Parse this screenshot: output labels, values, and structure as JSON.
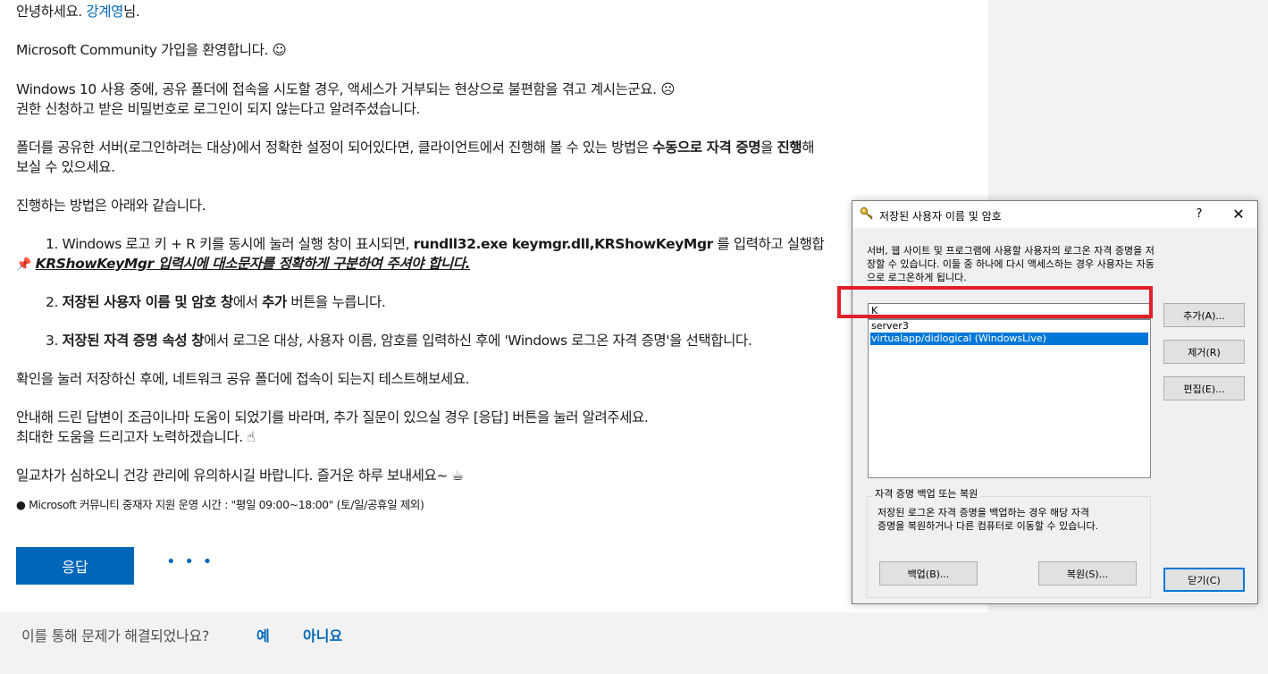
{
  "post": {
    "greeting_prefix": "안녕하세요. ",
    "greeting_name": "강계영",
    "greeting_suffix": "님.",
    "welcome": "Microsoft Community 가입을 환영합니다. ☺",
    "issue_line1": "Windows 10 사용 중에, 공유 폴더에 접속을 시도할 경우, 액세스가 거부되는 현상으로 불편함을 겪고 계시는군요. ☹",
    "issue_line2": "권한 신청하고 받은 비밀번호로 로그인이 되지 않는다고 알려주셨습니다.",
    "cause_pre": "폴더를 공유한 서버(로그인하려는 대상)에서 정확한 설정이 되어있다면, 클라이언트에서 진행해 볼 수 있는 방법은 ",
    "cause_b1": "수동으로 자격 증명",
    "cause_mid": "을 ",
    "cause_b2": "진행",
    "cause_post": "해",
    "cause_line2": "보실 수 있으세요.",
    "method_intro": "진행하는 방법은 아래와 같습니다.",
    "step1_pre": "1. Windows 로고 키 + R 키를 동시에 눌러 실행 창이 표시되면, ",
    "step1_cmd": "rundll32.exe keymgr.dll,KRShowKeyMgr",
    "step1_post": " 를 입력하고 실행합",
    "step1_note": "KRShowKeyMgr 입력시에 대소문자를 정확하게 구분하여 주셔야 합니다.",
    "step2_pre": "2. ",
    "step2_b1": "저장된 사용자 이름 및 암호 창",
    "step2_mid": "에서 ",
    "step2_b2": "추가",
    "step2_post": " 버튼을 누릅니다.",
    "step3_pre": "3. ",
    "step3_b1": "저장된 자격 증명 속성 창",
    "step3_post": "에서 로그온 대상, 사용자 이름, 암호를 입력하신 후에 'Windows 로그온 자격 증명'을 선택합니다.",
    "confirm": "확인을 눌러 저장하신 후에, 네트워크 공유 폴더에 접속이 되는지 테스트해보세요.",
    "closing1": "안내해 드린 답변이 조금이나마 도움이 되었기를 바라며, 추가 질문이 있으실 경우 [응답] 버튼을 눌러 알려주세요.",
    "closing2": "최대한 도움을 드리고자 노력하겠습니다. ☝",
    "farewell": "일교차가 심하오니 건강 관리에 유의하시길 바랍니다. 즐거운 하루 보내세요~ ☕",
    "hours_note": "● Microsoft 커뮤니티 중재자 지원 운영 시간 : \"평일 09:00~18:00\" (토/일/공휴일 제외)",
    "reply_button": "응답",
    "more_dots": "• • •"
  },
  "footer": {
    "question": "이를 통해 문제가 해결되었나요?",
    "yes": "예",
    "no": "아니요"
  },
  "dialog": {
    "title": "저장된 사용자 이름 및 암호",
    "help": "?",
    "close": "✕",
    "desc_line1": "서버, 웹 사이트 및 프로그램에 사용할 사용자의 로그온 자격 증명을 저",
    "desc_line2": "장할 수 있습니다. 이들 중 하나에 다시 액세스하는 경우 사용자는 자동",
    "desc_line3": "으로 로그온하게 됩니다.",
    "filter_value": "K",
    "list_items": [
      "server3",
      "virtualapp/didlogical (WindowsLive)"
    ],
    "selected_index": 1,
    "add_button": "추가(A)...",
    "remove_button": "제거(R)",
    "edit_button": "편집(E)...",
    "group_title": "자격 증명 백업 또는 복원",
    "group_desc_line1": "저장된 로그온 자격 증명을 백업하는 경우 해당 자격",
    "group_desc_line2": "증명을 복원하거나 다른 컴퓨터로 이동할 수 있습니다.",
    "backup_button": "백업(B)...",
    "restore_button": "복원(S)...",
    "close_button": "닫기(C)",
    "highlight_color": "#e0202a",
    "selection_color": "#0078d7"
  }
}
